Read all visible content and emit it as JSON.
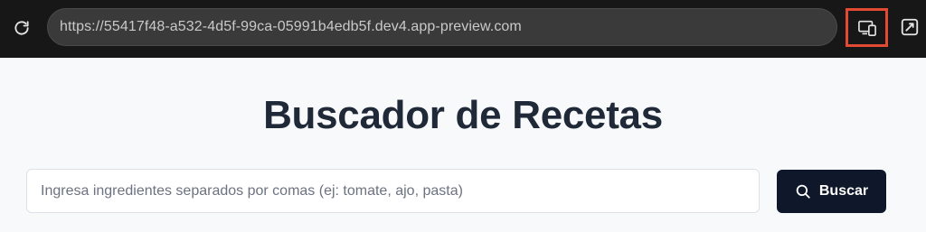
{
  "browser": {
    "url": "https://55417f48-a532-4d5f-99ca-05991b4edb5f.dev4.app-preview.com",
    "icons": {
      "reload": "reload-icon",
      "devices": "devices-icon",
      "popout": "external-link-icon"
    },
    "highlight_color": "#e34a33"
  },
  "page": {
    "title": "Buscador de Recetas",
    "search": {
      "placeholder": "Ingresa ingredientes separados por comas (ej: tomate, ajo, pasta)",
      "value": "",
      "button_label": "Buscar",
      "button_icon": "search-icon"
    }
  },
  "colors": {
    "chrome_bg": "#171717",
    "page_bg": "#f8f9fb",
    "title": "#1f2937",
    "button_bg": "#0f172a"
  }
}
